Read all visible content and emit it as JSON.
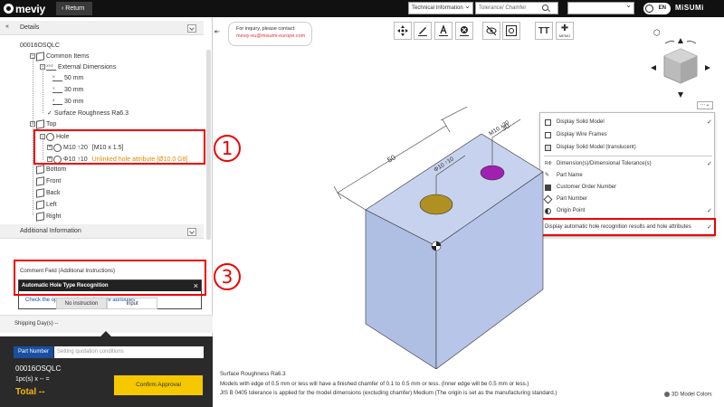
{
  "header": {
    "logo_text": "meviy",
    "return_label": "Return",
    "tech_select": "Technical Information",
    "search_placeholder": "Tolerance/ Chamfer",
    "lang": "EN",
    "brand": "MiSUMi"
  },
  "details": {
    "title": "Details",
    "part_id": "00016OSQLC",
    "common_items": "Common Items",
    "external_dimensions": "External Dimensions",
    "dim_x": "50 mm",
    "dim_y": "30 mm",
    "dim_z": "30 mm",
    "surface_roughness": "Surface Roughness Ra6.3",
    "top": "Top",
    "hole": "Hole",
    "hole1_name": "M10 ↑20",
    "hole1_detail": "[M10 x 1.5]",
    "hole2_name": "Φ10 ↑10",
    "hole2_detail": "Unlinked hole attribute [Ø10.0 G8]",
    "bottom": "Bottom",
    "front": "Front",
    "back": "Back",
    "left": "Left",
    "right": "Right",
    "axis_x": "X",
    "axis_y": "Y",
    "axis_z": "Z"
  },
  "additional": {
    "title": "Additional Information",
    "comment_label": "Comment Field (Additional Instructions)",
    "popup_title": "Automatic Hole Type Recognition",
    "popup_link": "Check the operational rules for hole attributes",
    "no_instruction": "No instruction",
    "input": "Input"
  },
  "shipping": {
    "label": "Shipping Day(s) --"
  },
  "order": {
    "part_number_label": "Part Number",
    "part_number_placeholder": "Setting quotation conditions",
    "part_number_value": "00016OSQLC",
    "qty": "1pc(s)  x -- =",
    "total": "Total --",
    "confirm_label": "Confirm Approval"
  },
  "inquiry": {
    "line1": "For inquiry, please contact:",
    "line2": "meviy-eu@misumi-europe.com"
  },
  "toolbar": {
    "text_label": "TT",
    "frames_label": "MEMO"
  },
  "menu": {
    "items": [
      "Display Solid Model",
      "Display Wire Frames",
      "Display Solid Model (translucent)",
      "Dimension(s)/Dimensional Tolerance(s)",
      "Part Name",
      "Customer Order Number",
      "Part Number",
      "Origin Point",
      "Display automatic hole recognition results and hole attributes"
    ]
  },
  "model": {
    "dim_50": "50",
    "dim_30": "30",
    "hole_label_1": "M10 ↑20",
    "hole_label_2": "Φ10 ↑10",
    "face_color": "#aebfe3",
    "hole1_color": "#a020b0",
    "hole2_color": "#b09020"
  },
  "bottom_info": {
    "line1": "Surface Roughness Ra6.3",
    "line2": "Models with edge of 0.5 mm or less will have a finished chamfer of 0.1 to 0.5 mm or less. (Inner edge will be 0.5 mm or less.)",
    "line3": "JIS B 0405 tolerance is applied for the model dimensions (excluding chamfer) Medium (The origin is set as the manufacturing standard.)",
    "model_colors": "3D Model Colors"
  },
  "annotations": {
    "n1": "1",
    "n2": "2",
    "n3": "3"
  },
  "colors": {
    "accent_blue": "#1a4fa0",
    "highlight_red": "#e00000",
    "confirm_yellow": "#f5c800"
  }
}
